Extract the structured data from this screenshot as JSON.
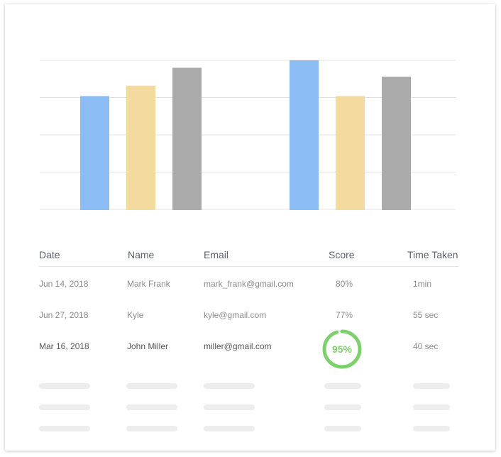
{
  "colors": {
    "blue": "#8bbcf4",
    "yellow": "#f4da9e",
    "gray": "#aaaaaa",
    "grid": "#e3e3e3",
    "score_ring": "#7ed06c",
    "score_ring_track": "#eeeeee"
  },
  "chart_data": {
    "type": "bar",
    "categories": [
      "",
      ""
    ],
    "series": [
      {
        "values": [
          76,
          100
        ],
        "color": "#8bbcf4"
      },
      {
        "values": [
          83,
          76
        ],
        "color": "#f4da9e"
      },
      {
        "values": [
          95,
          89
        ],
        "color": "#aaaaaa"
      }
    ],
    "ylim": [
      0,
      100
    ],
    "grid": true,
    "legend": "none"
  },
  "table": {
    "headers": [
      "Date",
      "Name",
      "Email",
      "Score",
      "Time Taken"
    ],
    "rows": [
      {
        "date": "Jun 14, 2018",
        "name": "Mark Frank",
        "email": "mark_frank@gmail.com",
        "score": "80%",
        "time": "1min"
      },
      {
        "date": "Jun 27, 2018",
        "name": "Kyle",
        "email": "kyle@gmail.com",
        "score": "77%",
        "time": "55 sec"
      },
      {
        "date": "Mar 16, 2018",
        "name": "John Miller",
        "email": "miller@gmail.com",
        "score": "95%",
        "time": "40 sec",
        "score_fraction": 0.95
      }
    ]
  }
}
